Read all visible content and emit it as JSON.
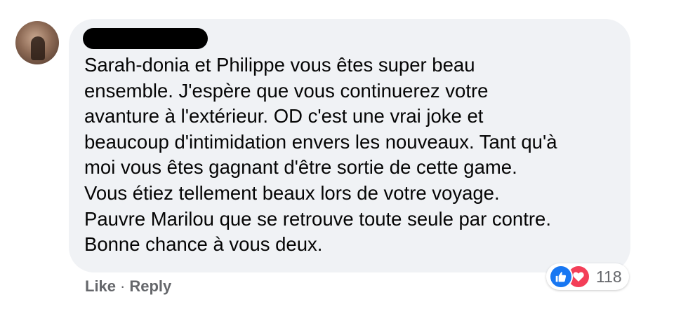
{
  "comment": {
    "author_redacted": true,
    "text_lines": [
      "Sarah-donia et Philippe vous êtes super beau",
      "ensemble. J'espère que vous continuerez votre",
      "avanture à l'extérieur. OD c'est une vrai joke et",
      "beaucoup d'intimidation envers les nouveaux. Tant qu'à",
      "moi vous êtes gagnant d'être sortie de cette game.",
      "Vous étiez tellement beaux lors de votre voyage.",
      "Pauvre Marilou que se retrouve toute seule par contre.",
      "Bonne chance à vous deux."
    ]
  },
  "reactions": {
    "icons": [
      "like-icon",
      "love-icon"
    ],
    "count": "118"
  },
  "actions": {
    "like_label": "Like",
    "separator": "·",
    "reply_label": "Reply"
  },
  "colors": {
    "bubble_bg": "#f0f2f5",
    "text": "#050505",
    "secondary_text": "#65676b",
    "like_blue": "#1877f2",
    "love_red": "#f33e58"
  }
}
